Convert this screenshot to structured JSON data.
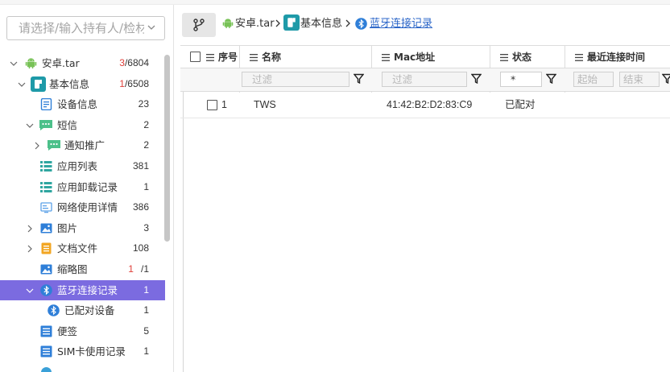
{
  "selector": {
    "placeholder": "请选择/输入持有人/检材"
  },
  "tree": [
    {
      "name": "android-icon",
      "label": "安卓.tar",
      "count_red": "3",
      "count": "/6804",
      "expanded": true,
      "level": 0
    },
    {
      "name": "info-icon",
      "label": "基本信息",
      "count_red": "1",
      "count": "/6508",
      "expanded": true,
      "level": 1
    },
    {
      "name": "device-info-icon",
      "label": "设备信息",
      "count": "23",
      "level": 2
    },
    {
      "name": "sms-icon",
      "label": "短信",
      "count": "2",
      "expanded": true,
      "level": 2
    },
    {
      "name": "sms-icon",
      "label": "通知推广",
      "count": "2",
      "collapsed": true,
      "level": 3
    },
    {
      "name": "list-icon",
      "label": "应用列表",
      "count": "381",
      "level": 2
    },
    {
      "name": "list-icon",
      "label": "应用卸载记录",
      "count": "1",
      "level": 2
    },
    {
      "name": "network-icon",
      "label": "网络使用详情",
      "count": "386",
      "level": 2
    },
    {
      "name": "image-icon",
      "label": "图片",
      "count": "3",
      "collapsed": true,
      "level": 2
    },
    {
      "name": "document-icon",
      "label": "文档文件",
      "count": "108",
      "collapsed": true,
      "level": 2
    },
    {
      "name": "image-icon",
      "label": "缩略图",
      "count_red": "1",
      "count": "/1",
      "level": 2
    },
    {
      "name": "bluetooth-icon",
      "label": "蓝牙连接记录",
      "count": "1",
      "expanded": true,
      "selected": true,
      "level": 2
    },
    {
      "name": "bluetooth-icon",
      "label": "已配对设备",
      "count": "1",
      "level": 3
    },
    {
      "name": "list-icon",
      "label": "便签",
      "count": "5",
      "level": 2
    },
    {
      "name": "list-icon",
      "label": "SIM卡使用记录",
      "count": "1",
      "level": 2
    }
  ],
  "breadcrumb": {
    "root": "安卓.tar",
    "parent": "基本信息",
    "current": "蓝牙连接记录"
  },
  "table": {
    "columns": [
      "序号",
      "名称",
      "Mac地址",
      "状态",
      "最近连接时间"
    ],
    "filters": {
      "placeholder": "过滤",
      "status_value": "*",
      "start_placeholder": "起始",
      "end_placeholder": "结束"
    },
    "rows": [
      {
        "index": "1",
        "name": "TWS",
        "mac": "41:42:B2:D2:83:C9",
        "status": "已配对",
        "time": ""
      }
    ]
  },
  "colors": {
    "selected_row": "#7b6be0",
    "link": "#2a65c8",
    "count_red": "#e0403a",
    "android_green": "#78c257"
  }
}
